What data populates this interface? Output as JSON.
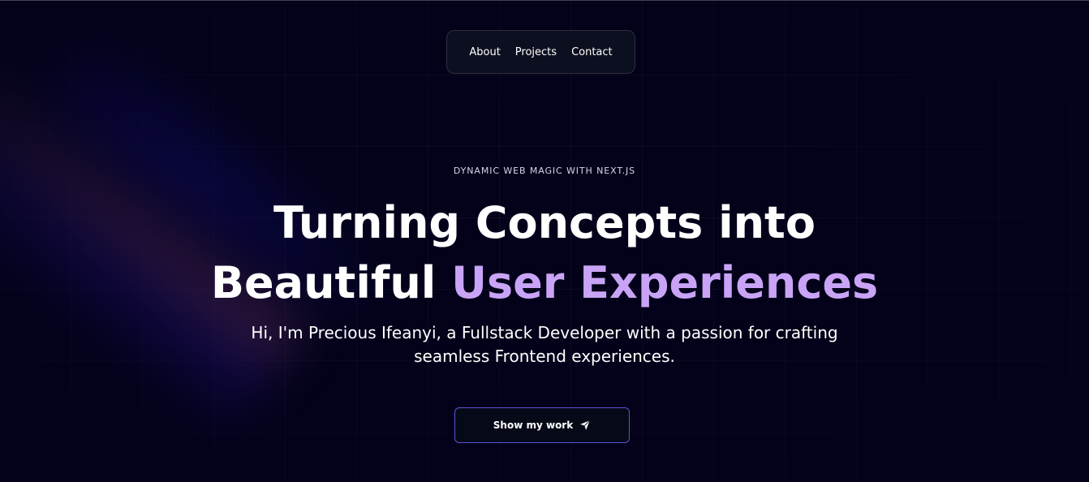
{
  "nav": {
    "items": [
      {
        "label": "About"
      },
      {
        "label": "Projects"
      },
      {
        "label": "Contact"
      }
    ]
  },
  "hero": {
    "eyebrow": "DYNAMIC WEB MAGIC WITH NEXT.JS",
    "headline_line1": "Turning Concepts into",
    "headline_line2_prefix": "Beautiful",
    "headline_line2_accent": "User Experiences",
    "subtitle": "Hi, I'm Precious Ifeanyi, a Fullstack Developer with a passion for crafting seamless Frontend experiences.",
    "cta_label": "Show my work",
    "cta_icon": "send-icon"
  },
  "colors": {
    "background": "#03021a",
    "accent": "#c9a4f6",
    "cta_border": "#5b52d6"
  }
}
